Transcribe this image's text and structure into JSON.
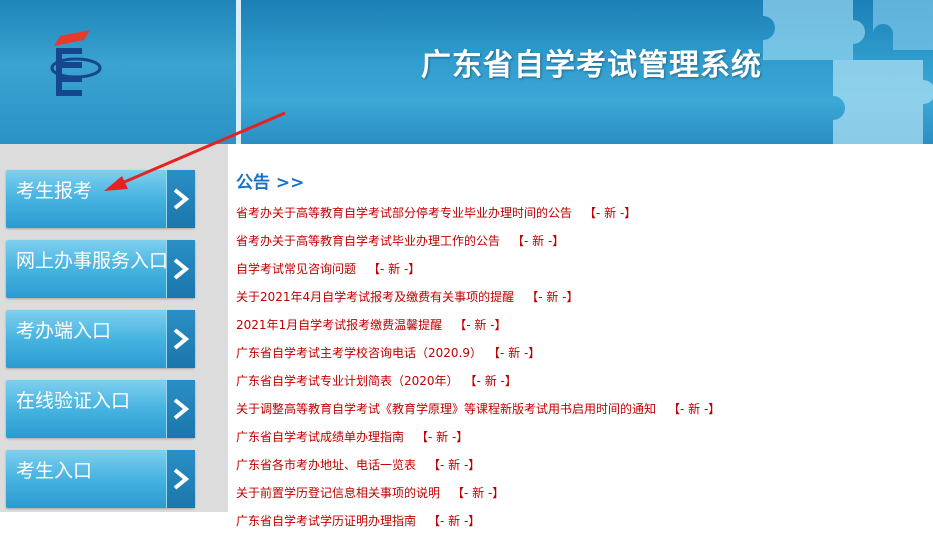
{
  "header": {
    "title": "广东省自学考试管理系统"
  },
  "sidebar": {
    "items": [
      {
        "label": "考生报考"
      },
      {
        "label": "网上办事服务入口"
      },
      {
        "label": "考办端入口"
      },
      {
        "label": "在线验证入口"
      },
      {
        "label": "考生入口"
      }
    ]
  },
  "announcements": {
    "title": "公告 >>",
    "tag": "【- 新 -】",
    "items": [
      {
        "text": "省考办关于高等教育自学考试部分停考专业毕业办理时间的公告"
      },
      {
        "text": "省考办关于高等教育自学考试毕业办理工作的公告"
      },
      {
        "text": "自学考试常见咨询问题"
      },
      {
        "text": "关于2021年4月自学考试报考及缴费有关事项的提醒"
      },
      {
        "text": "2021年1月自学考试报考缴费温馨提醒"
      },
      {
        "text": "广东省自学考试主考学校咨询电话（2020.9）"
      },
      {
        "text": "广东省自学考试专业计划简表（2020年）"
      },
      {
        "text": "关于调整高等教育自学考试《教育学原理》等课程新版考试用书启用时间的通知"
      },
      {
        "text": "广东省自学考试成绩单办理指南"
      },
      {
        "text": "广东省各市考办地址、电话一览表"
      },
      {
        "text": "关于前置学历登记信息相关事项的说明"
      },
      {
        "text": "广东省自学考试学历证明办理指南"
      }
    ]
  },
  "colors": {
    "accent": "#1a73c4",
    "notice_text": "#c00000",
    "annotation": "#e32222"
  }
}
